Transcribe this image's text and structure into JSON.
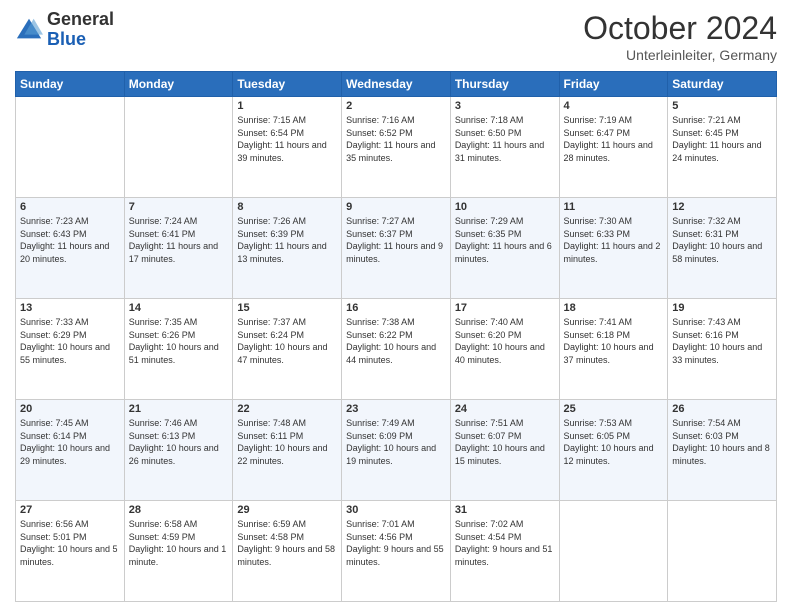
{
  "header": {
    "logo_line1": "General",
    "logo_line2": "Blue",
    "title": "October 2024",
    "subtitle": "Unterleinleiter, Germany"
  },
  "calendar": {
    "days_of_week": [
      "Sunday",
      "Monday",
      "Tuesday",
      "Wednesday",
      "Thursday",
      "Friday",
      "Saturday"
    ],
    "weeks": [
      [
        {
          "day": "",
          "info": ""
        },
        {
          "day": "",
          "info": ""
        },
        {
          "day": "1",
          "info": "Sunrise: 7:15 AM\nSunset: 6:54 PM\nDaylight: 11 hours and 39 minutes."
        },
        {
          "day": "2",
          "info": "Sunrise: 7:16 AM\nSunset: 6:52 PM\nDaylight: 11 hours and 35 minutes."
        },
        {
          "day": "3",
          "info": "Sunrise: 7:18 AM\nSunset: 6:50 PM\nDaylight: 11 hours and 31 minutes."
        },
        {
          "day": "4",
          "info": "Sunrise: 7:19 AM\nSunset: 6:47 PM\nDaylight: 11 hours and 28 minutes."
        },
        {
          "day": "5",
          "info": "Sunrise: 7:21 AM\nSunset: 6:45 PM\nDaylight: 11 hours and 24 minutes."
        }
      ],
      [
        {
          "day": "6",
          "info": "Sunrise: 7:23 AM\nSunset: 6:43 PM\nDaylight: 11 hours and 20 minutes."
        },
        {
          "day": "7",
          "info": "Sunrise: 7:24 AM\nSunset: 6:41 PM\nDaylight: 11 hours and 17 minutes."
        },
        {
          "day": "8",
          "info": "Sunrise: 7:26 AM\nSunset: 6:39 PM\nDaylight: 11 hours and 13 minutes."
        },
        {
          "day": "9",
          "info": "Sunrise: 7:27 AM\nSunset: 6:37 PM\nDaylight: 11 hours and 9 minutes."
        },
        {
          "day": "10",
          "info": "Sunrise: 7:29 AM\nSunset: 6:35 PM\nDaylight: 11 hours and 6 minutes."
        },
        {
          "day": "11",
          "info": "Sunrise: 7:30 AM\nSunset: 6:33 PM\nDaylight: 11 hours and 2 minutes."
        },
        {
          "day": "12",
          "info": "Sunrise: 7:32 AM\nSunset: 6:31 PM\nDaylight: 10 hours and 58 minutes."
        }
      ],
      [
        {
          "day": "13",
          "info": "Sunrise: 7:33 AM\nSunset: 6:29 PM\nDaylight: 10 hours and 55 minutes."
        },
        {
          "day": "14",
          "info": "Sunrise: 7:35 AM\nSunset: 6:26 PM\nDaylight: 10 hours and 51 minutes."
        },
        {
          "day": "15",
          "info": "Sunrise: 7:37 AM\nSunset: 6:24 PM\nDaylight: 10 hours and 47 minutes."
        },
        {
          "day": "16",
          "info": "Sunrise: 7:38 AM\nSunset: 6:22 PM\nDaylight: 10 hours and 44 minutes."
        },
        {
          "day": "17",
          "info": "Sunrise: 7:40 AM\nSunset: 6:20 PM\nDaylight: 10 hours and 40 minutes."
        },
        {
          "day": "18",
          "info": "Sunrise: 7:41 AM\nSunset: 6:18 PM\nDaylight: 10 hours and 37 minutes."
        },
        {
          "day": "19",
          "info": "Sunrise: 7:43 AM\nSunset: 6:16 PM\nDaylight: 10 hours and 33 minutes."
        }
      ],
      [
        {
          "day": "20",
          "info": "Sunrise: 7:45 AM\nSunset: 6:14 PM\nDaylight: 10 hours and 29 minutes."
        },
        {
          "day": "21",
          "info": "Sunrise: 7:46 AM\nSunset: 6:13 PM\nDaylight: 10 hours and 26 minutes."
        },
        {
          "day": "22",
          "info": "Sunrise: 7:48 AM\nSunset: 6:11 PM\nDaylight: 10 hours and 22 minutes."
        },
        {
          "day": "23",
          "info": "Sunrise: 7:49 AM\nSunset: 6:09 PM\nDaylight: 10 hours and 19 minutes."
        },
        {
          "day": "24",
          "info": "Sunrise: 7:51 AM\nSunset: 6:07 PM\nDaylight: 10 hours and 15 minutes."
        },
        {
          "day": "25",
          "info": "Sunrise: 7:53 AM\nSunset: 6:05 PM\nDaylight: 10 hours and 12 minutes."
        },
        {
          "day": "26",
          "info": "Sunrise: 7:54 AM\nSunset: 6:03 PM\nDaylight: 10 hours and 8 minutes."
        }
      ],
      [
        {
          "day": "27",
          "info": "Sunrise: 6:56 AM\nSunset: 5:01 PM\nDaylight: 10 hours and 5 minutes."
        },
        {
          "day": "28",
          "info": "Sunrise: 6:58 AM\nSunset: 4:59 PM\nDaylight: 10 hours and 1 minute."
        },
        {
          "day": "29",
          "info": "Sunrise: 6:59 AM\nSunset: 4:58 PM\nDaylight: 9 hours and 58 minutes."
        },
        {
          "day": "30",
          "info": "Sunrise: 7:01 AM\nSunset: 4:56 PM\nDaylight: 9 hours and 55 minutes."
        },
        {
          "day": "31",
          "info": "Sunrise: 7:02 AM\nSunset: 4:54 PM\nDaylight: 9 hours and 51 minutes."
        },
        {
          "day": "",
          "info": ""
        },
        {
          "day": "",
          "info": ""
        }
      ]
    ]
  }
}
